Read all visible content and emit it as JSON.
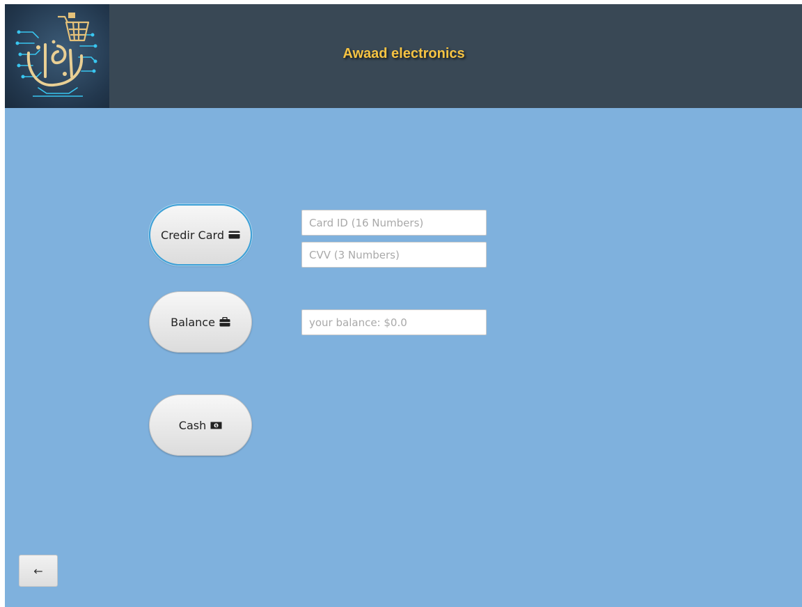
{
  "header": {
    "title": "Awaad electronics",
    "logo_icon": "shopping-cart-circuit-logo",
    "background_color": "#394855",
    "title_color": "#f6c342"
  },
  "payment_methods": [
    {
      "label": "Credir Card",
      "icon": "credit-card-icon",
      "selected": true
    },
    {
      "label": "Balance",
      "icon": "briefcase-icon",
      "selected": false
    },
    {
      "label": "Cash",
      "icon": "money-bill-icon",
      "selected": false
    }
  ],
  "fields": {
    "card_id_placeholder": "Card ID (16 Numbers)",
    "cvv_placeholder": "CVV (3 Numbers)",
    "balance_placeholder": "your balance: $0.0"
  },
  "back_button": {
    "label": "←",
    "icon": "back-arrow-icon"
  },
  "colors": {
    "page_background": "#7fb1dd",
    "selected_border": "#3ea0d6"
  }
}
